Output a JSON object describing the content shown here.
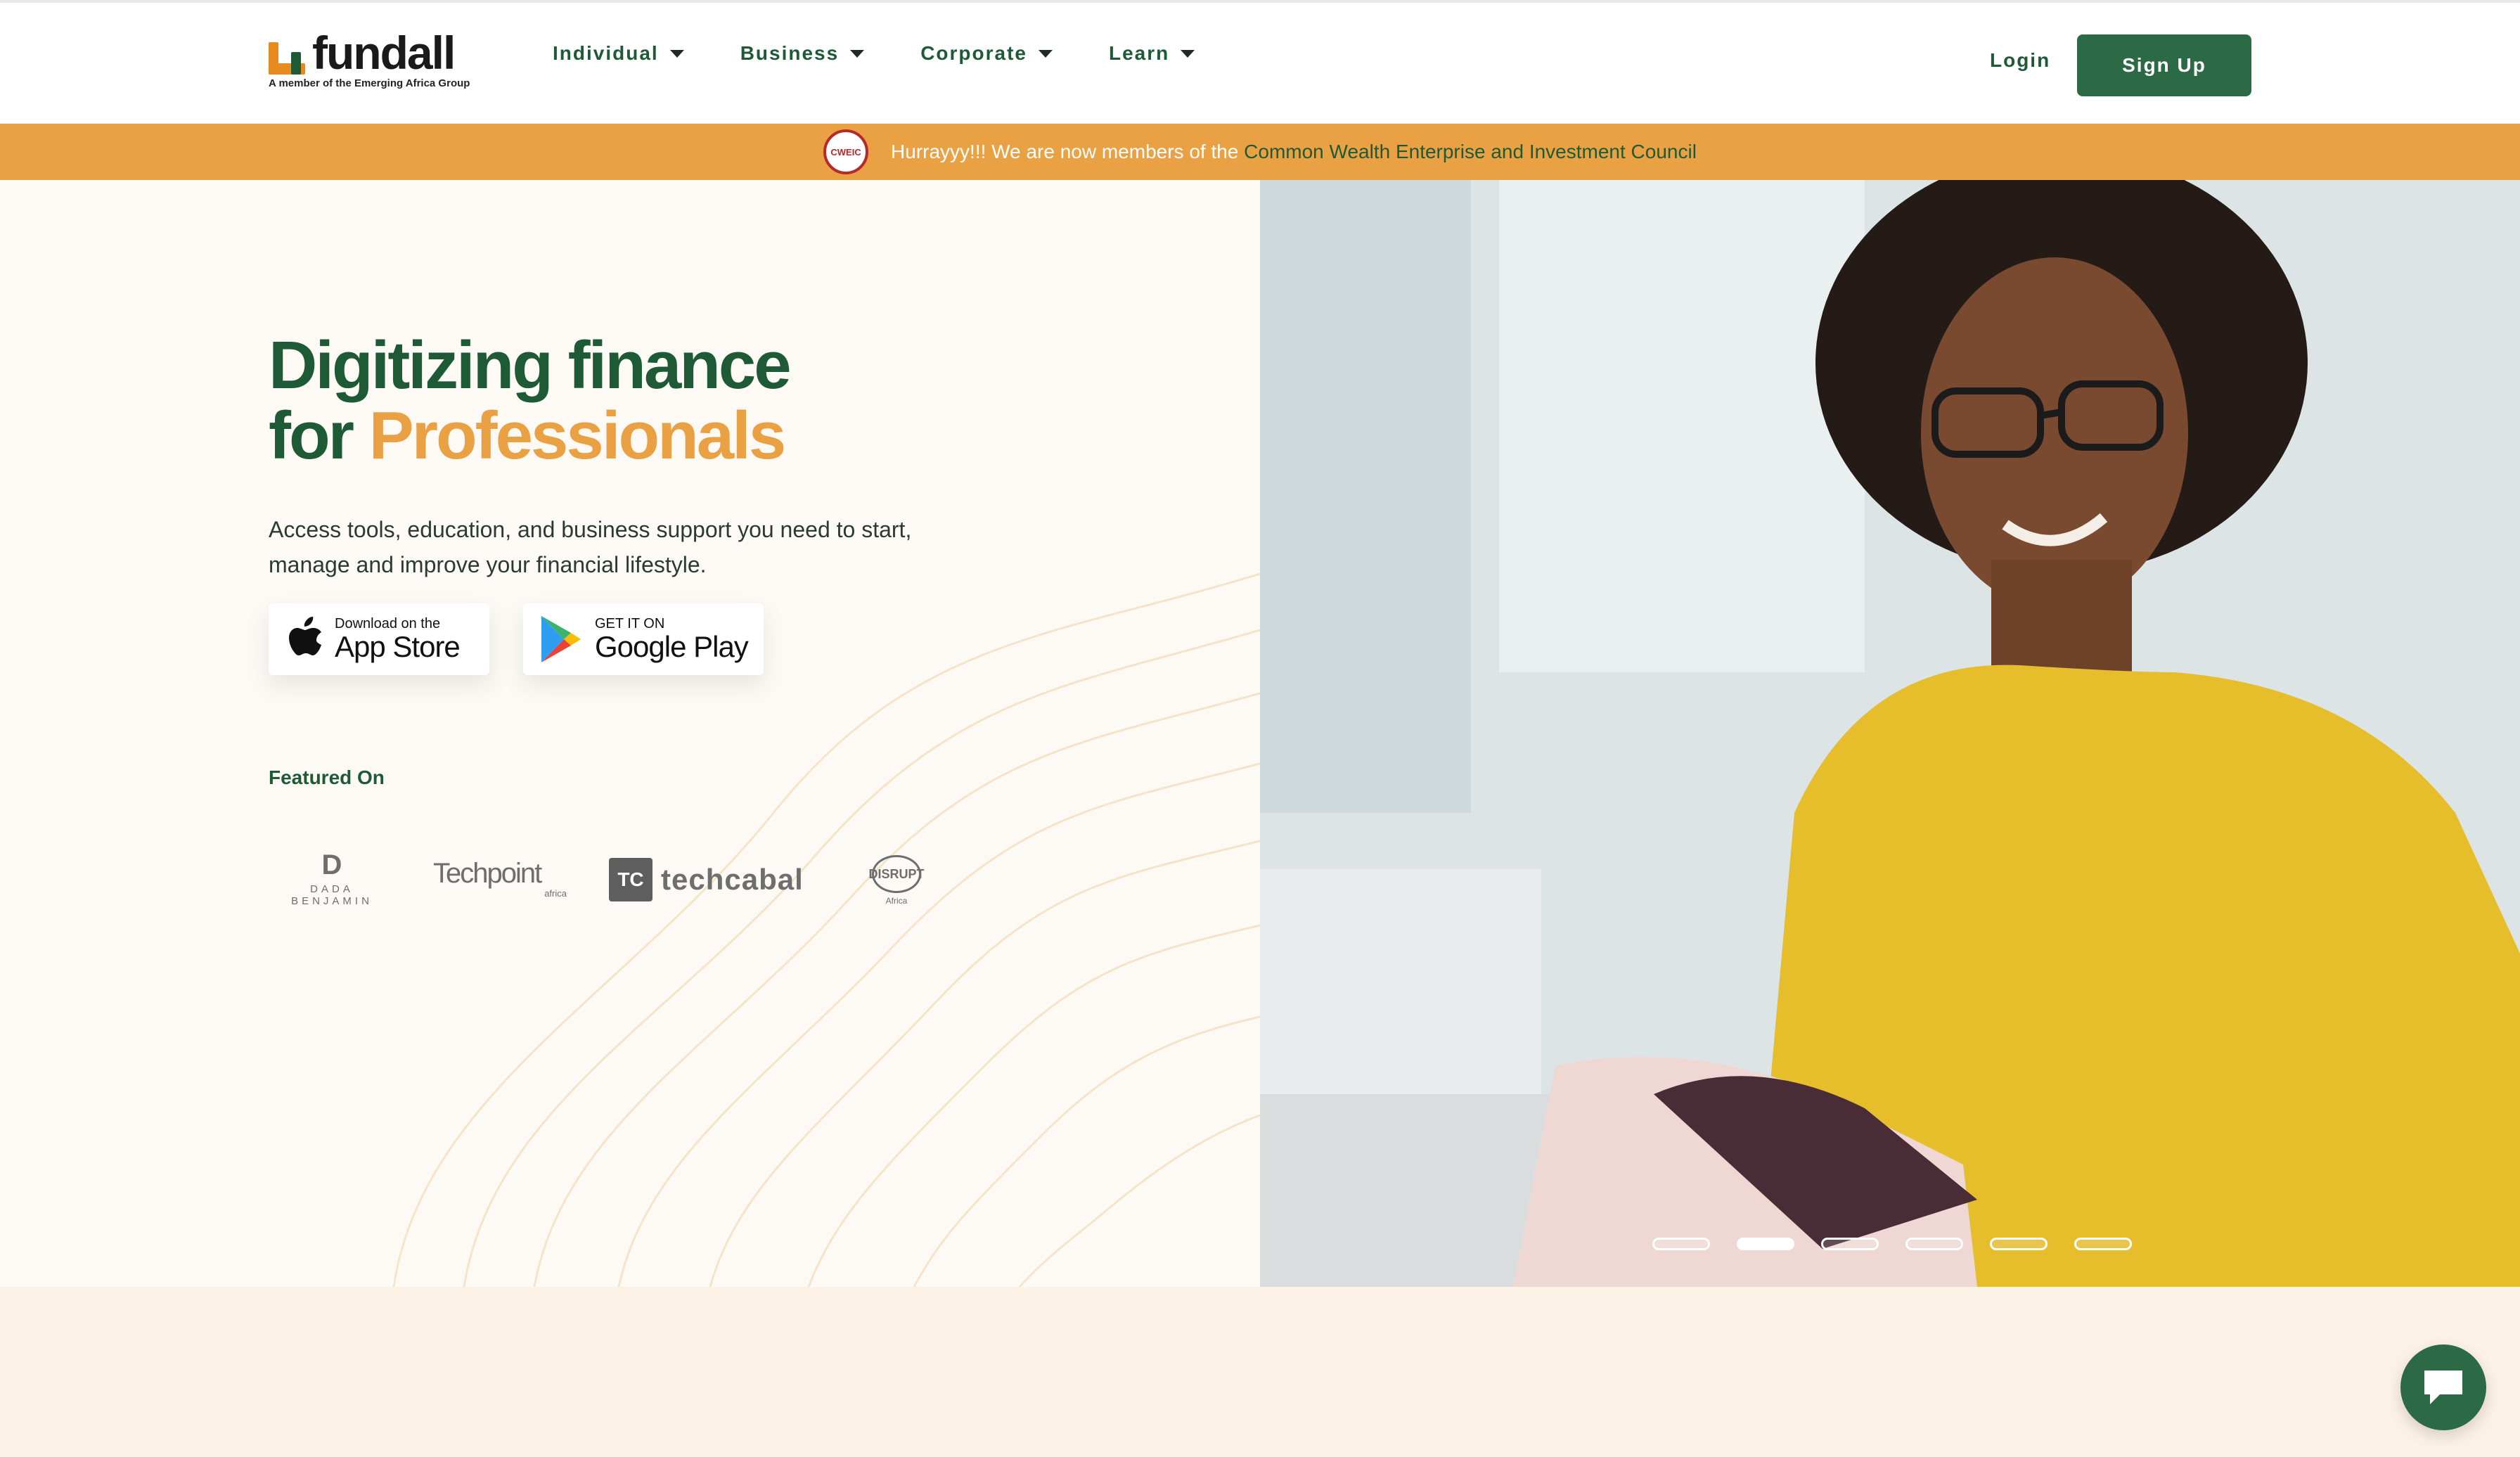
{
  "brand": {
    "name": "fundall",
    "tagline": "A member of the Emerging Africa Group"
  },
  "nav": {
    "items": [
      {
        "label": "Individual"
      },
      {
        "label": "Business"
      },
      {
        "label": "Corporate"
      },
      {
        "label": "Learn"
      }
    ],
    "login_label": "Login",
    "signup_label": "Sign Up"
  },
  "announcement": {
    "badge_text": "CWEIC",
    "text": "Hurrayyy!!! We are now members of the",
    "link_text": "Common Wealth Enterprise and Investment Council"
  },
  "hero": {
    "headline_line1": "Digitizing finance",
    "headline_for": "for",
    "headline_accent": "Professionals",
    "subtext": "Access tools, education, and business support you need to start, manage and improve your financial lifestyle.",
    "app_store": {
      "small": "Download on the",
      "big": "App Store"
    },
    "google_play": {
      "small": "GET IT ON",
      "big": "Google Play"
    },
    "featured_label": "Featured On",
    "featured": [
      {
        "name": "DADA BENJAMIN",
        "mark": "D"
      },
      {
        "name": "Techpoint",
        "sub": "africa"
      },
      {
        "name": "techcabal",
        "mark": "TC"
      },
      {
        "name": "DISRUPT",
        "sub": "Africa"
      }
    ],
    "carousel": {
      "slides": 6,
      "active_index": 1
    }
  },
  "colors": {
    "brand_green": "#1f5a37",
    "button_green": "#2b6a45",
    "accent_orange": "#e9a144",
    "badge_red": "#b52a2a"
  },
  "icons": {
    "chat": "chat-bubble-icon",
    "apple": "apple-icon",
    "google_play": "google-play-icon",
    "caret": "caret-down-icon"
  }
}
